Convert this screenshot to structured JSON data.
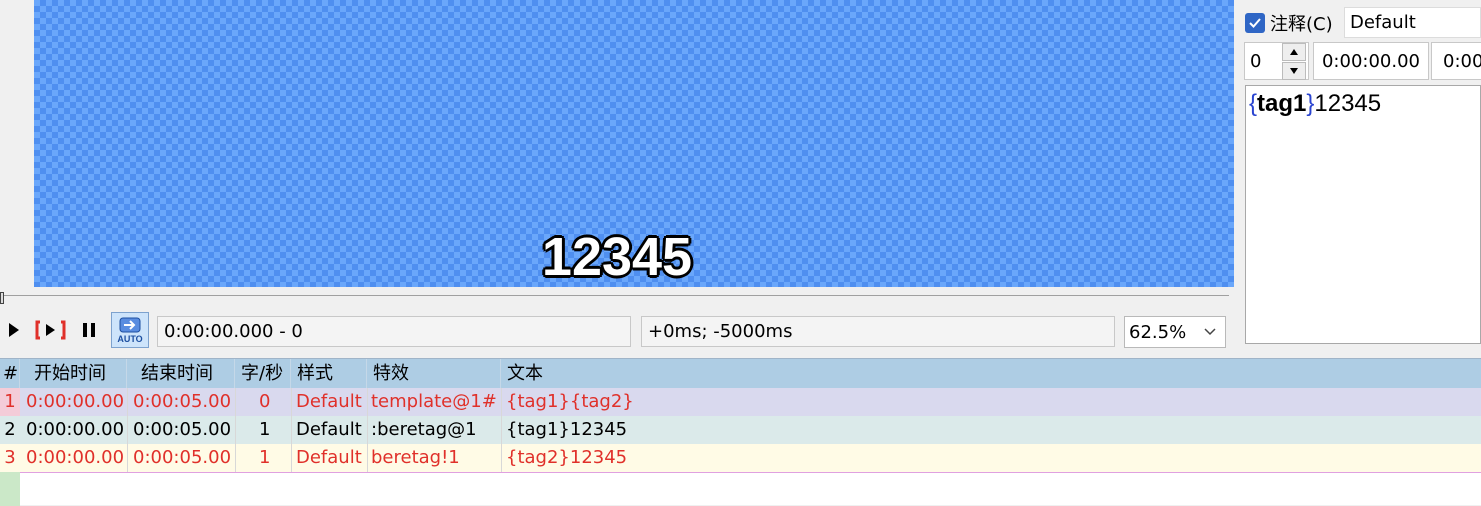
{
  "video": {
    "subtitle_text": "12345"
  },
  "controls": {
    "play_label": "▶",
    "play_line_label": "[▶]",
    "pause_label": "❚❚",
    "auto_label": "AUTO",
    "time_display": "0:00:00.000 - 0",
    "offset_display": "+0ms; -5000ms",
    "zoom_value": "62.5%"
  },
  "editor": {
    "comment_checked": true,
    "comment_label": "注释(C)",
    "style_value": "Default",
    "layer_value": "0",
    "start_time": "0:00:00.00",
    "end_time": "0:00",
    "text_brace_open": "{",
    "text_tag": "tag1",
    "text_brace_close": "}",
    "text_rest": "12345"
  },
  "grid": {
    "columns": [
      "#",
      "开始时间",
      "结束时间",
      "字/秒",
      "样式",
      "特效",
      "文本"
    ],
    "rows": [
      {
        "num": "1",
        "start": "0:00:00.00",
        "end": "0:00:05.00",
        "cps": "0",
        "style": "Default",
        "effect": "template@1#",
        "text": "{tag1}{tag2}",
        "comment": true
      },
      {
        "num": "2",
        "start": "0:00:00.00",
        "end": "0:00:05.00",
        "cps": "1",
        "style": "Default",
        "effect": ":beretag@1",
        "text": "{tag1}12345",
        "comment": false
      },
      {
        "num": "3",
        "start": "0:00:00.00",
        "end": "0:00:05.00",
        "cps": "1",
        "style": "Default",
        "effect": "beretag!1",
        "text": "{tag2}12345",
        "comment": true
      }
    ]
  },
  "colors": {
    "row_comment_1_bg": "#d9d9ee",
    "row_normal_bg": "#dbeaea",
    "row_comment_3_bg": "#fffbe6",
    "row_number_1_bg": "#f4ccd8",
    "header_bg": "#aecde4",
    "comment_text": "#e0302a"
  }
}
